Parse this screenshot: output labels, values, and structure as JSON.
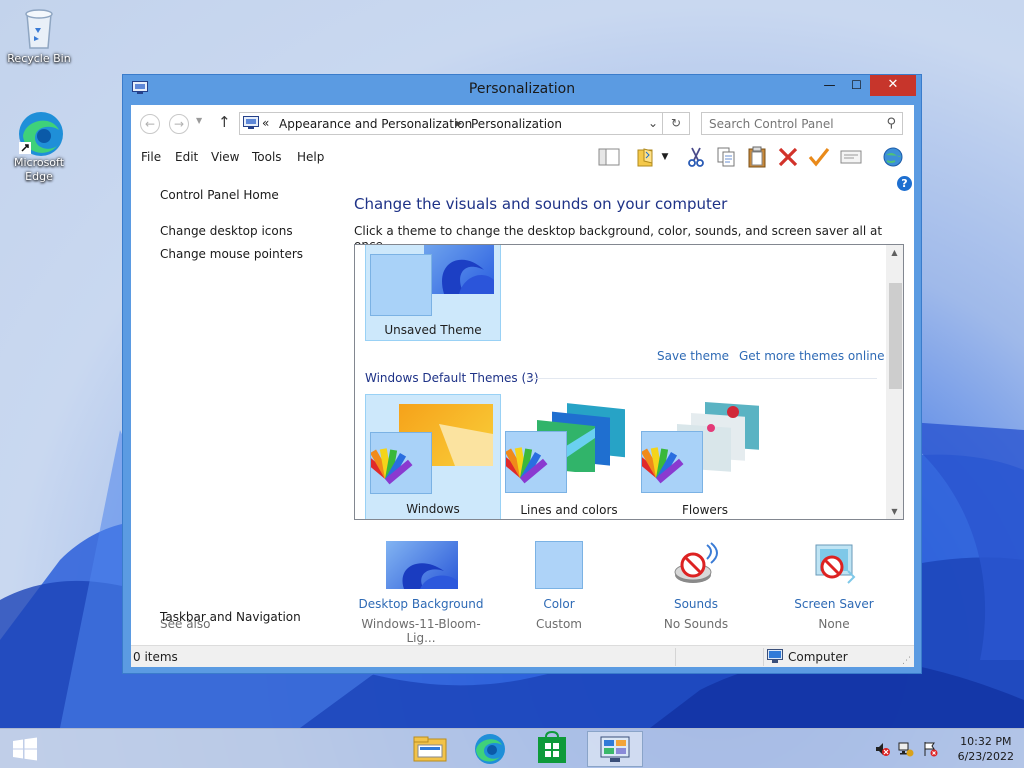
{
  "desktop": {
    "icons": [
      {
        "label": "Recycle Bin"
      },
      {
        "label": "Microsoft Edge"
      }
    ]
  },
  "window": {
    "title": "Personalization",
    "controls": {
      "minimize": "—",
      "maximize": "☐",
      "close": "✕"
    },
    "address": {
      "overflow": "«",
      "segments": [
        "Appearance and Personalization",
        "Personalization"
      ]
    },
    "search": {
      "placeholder": "Search Control Panel"
    },
    "menu": [
      "File",
      "Edit",
      "View",
      "Tools",
      "Help"
    ],
    "left_pane": {
      "home": "Control Panel Home",
      "links": [
        "Change desktop icons",
        "Change mouse pointers"
      ],
      "see_also_header": "See also",
      "see_also_links": [
        "Taskbar and Navigation"
      ]
    },
    "main": {
      "title": "Change the visuals and sounds on your computer",
      "description": "Click a theme to change the desktop background, color, sounds, and screen saver all at once.",
      "my_themes": [
        {
          "name": "Unsaved Theme",
          "selected": true
        }
      ],
      "save_theme": "Save theme",
      "get_more": "Get more themes online",
      "default_group": "Windows Default Themes (3)",
      "default_themes": [
        {
          "name": "Windows",
          "selected": true
        },
        {
          "name": "Lines and colors",
          "selected": false
        },
        {
          "name": "Flowers",
          "selected": false
        }
      ],
      "settings": [
        {
          "label": "Desktop Background",
          "value": "Windows-11-Bloom-Lig..."
        },
        {
          "label": "Color",
          "value": "Custom"
        },
        {
          "label": "Sounds",
          "value": "No Sounds"
        },
        {
          "label": "Screen Saver",
          "value": "None"
        }
      ]
    },
    "status": {
      "items": "0 items",
      "location": "Computer"
    }
  },
  "taskbar": {
    "time": "10:32 PM",
    "date": "6/23/2022",
    "apps": [
      "file-explorer",
      "edge",
      "store",
      "control-panel"
    ]
  },
  "colors": {
    "link": "#2e6ab5",
    "heading": "#1e3287",
    "close": "#c7352b",
    "title_bar": "#5b9be2"
  }
}
